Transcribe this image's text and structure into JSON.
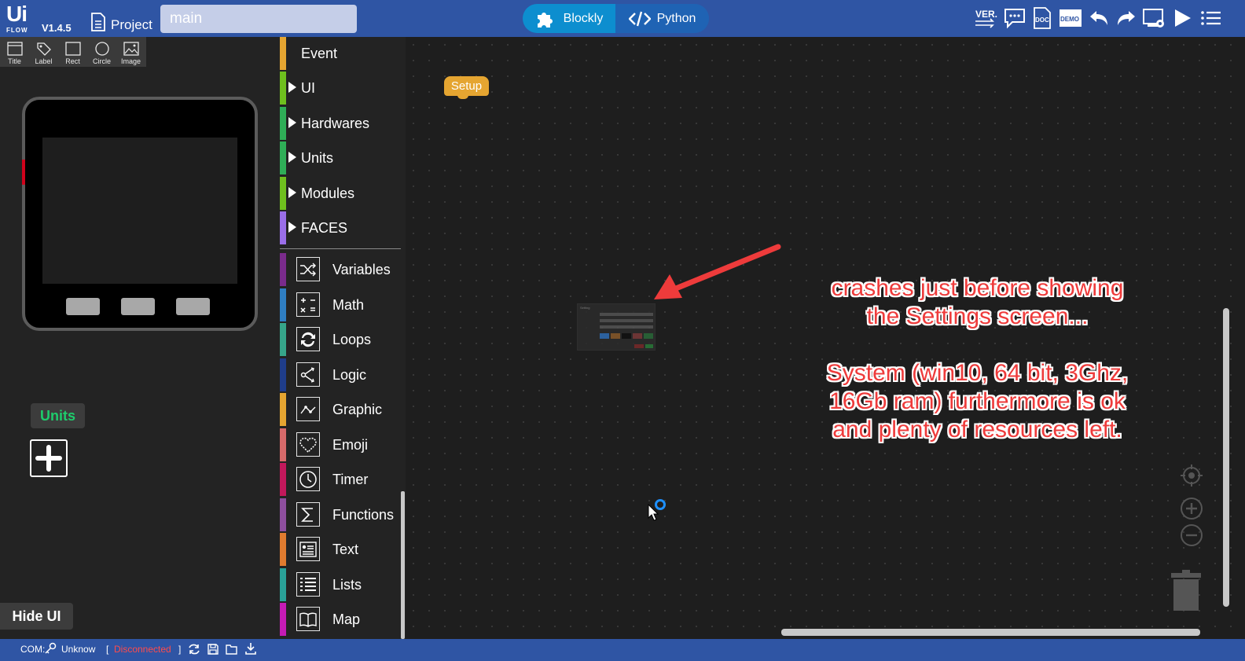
{
  "app": {
    "logo_top": "Ui",
    "logo_bottom": "FLOW",
    "version": "V1.4.5",
    "project_label": "Project",
    "file_name": "main"
  },
  "mode_switch": {
    "blockly_label": "Blockly",
    "python_label": "Python",
    "active": "Blockly"
  },
  "toolbar_icons": [
    "version-icon",
    "feedback-icon",
    "doc-icon",
    "demo-icon",
    "undo-icon",
    "redo-icon",
    "device-settings-icon",
    "run-icon",
    "menu-icon"
  ],
  "toolbar_text": {
    "ver": "VER.",
    "doc": "DOC",
    "demo": "DEMO"
  },
  "shape_tools": [
    "Title",
    "Label",
    "Rect",
    "Circle",
    "Image"
  ],
  "units_panel": {
    "label": "Units"
  },
  "hide_ui_label": "Hide UI",
  "toolbox": {
    "expandable": [
      {
        "label": "Event",
        "color": "#e5a531"
      },
      {
        "label": "UI",
        "color": "#6fbf1e"
      },
      {
        "label": "Hardwares",
        "color": "#2fae57"
      },
      {
        "label": "Units",
        "color": "#2fae57"
      },
      {
        "label": "Modules",
        "color": "#6fbf1e"
      },
      {
        "label": "FACES",
        "color": "#9a6ee8"
      }
    ],
    "builtin": [
      {
        "label": "Variables",
        "color": "#7a2b8c",
        "icon": "shuffle-icon"
      },
      {
        "label": "Math",
        "color": "#2f7ec2",
        "icon": "math-icon"
      },
      {
        "label": "Loops",
        "color": "#36a58a",
        "icon": "loop-icon"
      },
      {
        "label": "Logic",
        "color": "#1f3d8a",
        "icon": "logic-icon"
      },
      {
        "label": "Graphic",
        "color": "#e5a531",
        "icon": "graphic-icon"
      },
      {
        "label": "Emoji",
        "color": "#d76a6a",
        "icon": "heart-icon"
      },
      {
        "label": "Timer",
        "color": "#c2185b",
        "icon": "clock-icon"
      },
      {
        "label": "Functions",
        "color": "#8e4f9e",
        "icon": "sigma-icon"
      },
      {
        "label": "Text",
        "color": "#e07b2f",
        "icon": "text-card-icon"
      },
      {
        "label": "Lists",
        "color": "#2aa198",
        "icon": "list-icon"
      },
      {
        "label": "Map",
        "color": "#c51bb5",
        "icon": "book-icon"
      }
    ]
  },
  "workspace": {
    "setup_block": "Setup",
    "mini_settings_title": "Setting",
    "annotation": "crashes just before showing\nthe Settings screen...\n\nSystem (win10, 64 bit, 3Ghz,\n16Gb ram) furthermore is ok\nand plenty of resources left."
  },
  "status": {
    "com_label": "COM:",
    "port": "Unknow",
    "bracket_open": "[",
    "connection": "Disconnected",
    "bracket_close": "]"
  },
  "colors": {
    "topbar": "#2f55a4",
    "blockly_active": "#0d8ecf",
    "annotation_red": "#ee3b3b",
    "units_green": "#1ecc6c"
  }
}
